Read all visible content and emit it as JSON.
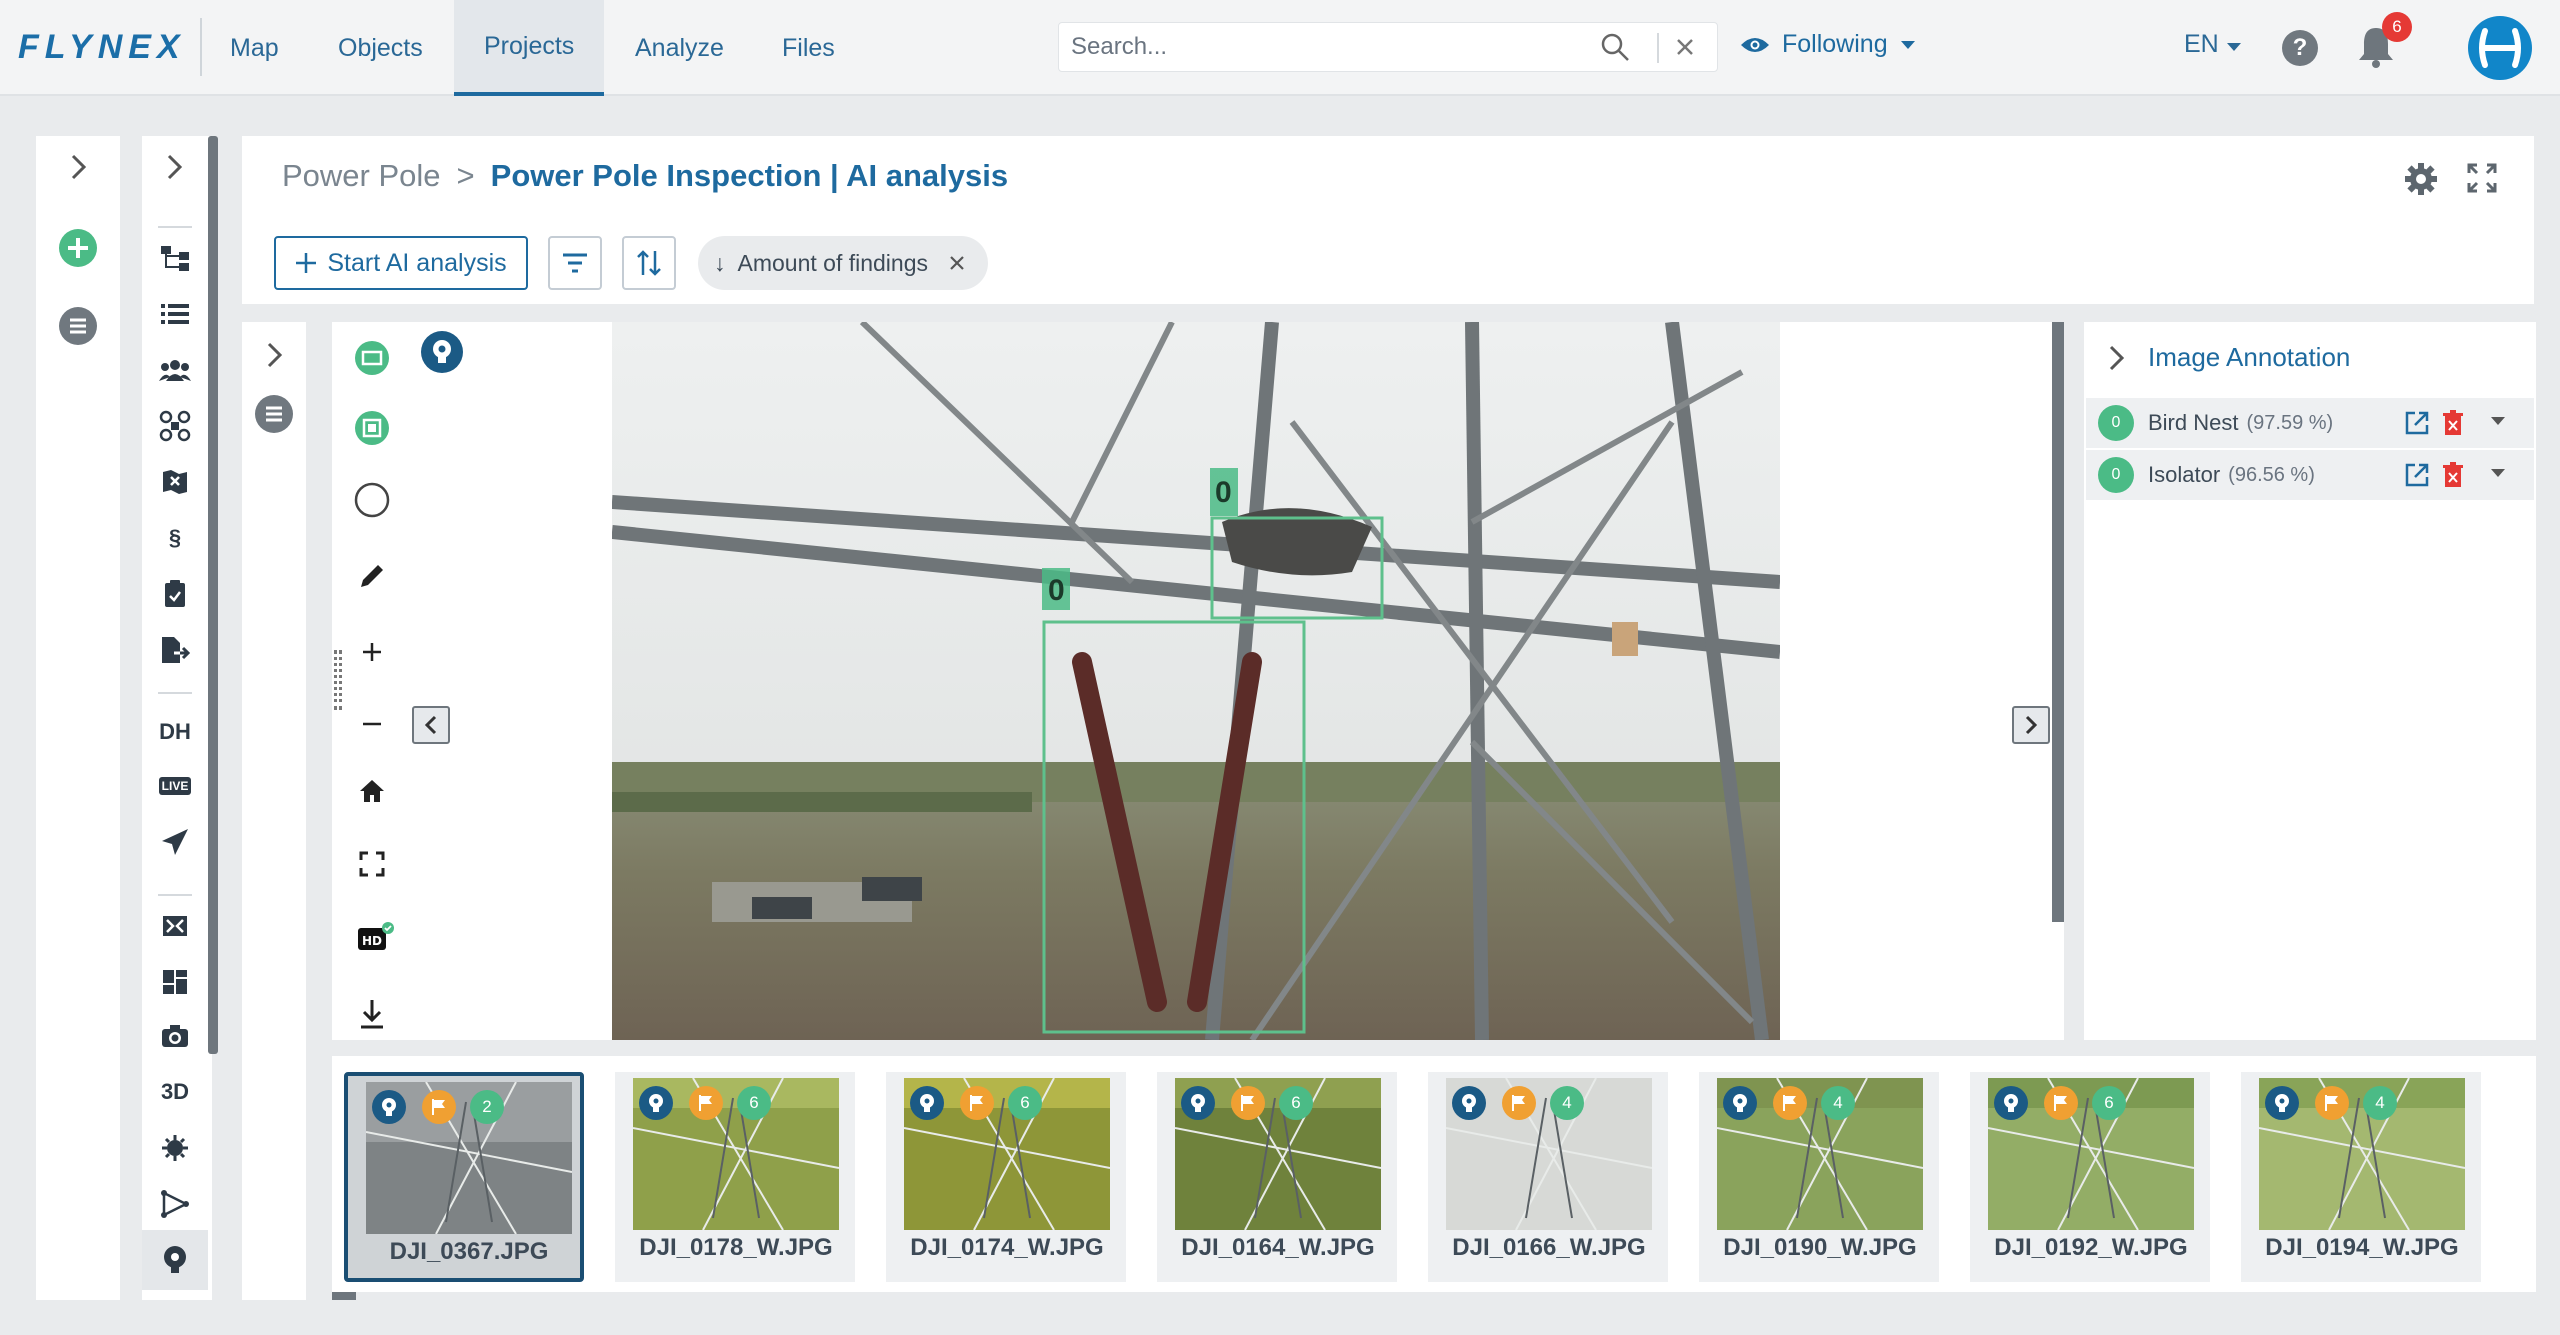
{
  "nav": {
    "logo": "FLYNEX",
    "items": [
      "Map",
      "Objects",
      "Projects",
      "Analyze",
      "Files"
    ],
    "active": "Projects",
    "search_placeholder": "Search...",
    "following": "Following",
    "language": "EN",
    "help": "?",
    "notifications": "6"
  },
  "rail_labels": {
    "dh": "DH",
    "live": "LIVE",
    "legal": "§",
    "threed": "3D"
  },
  "header": {
    "crumb_parent": "Power Pole",
    "crumb_sep": ">",
    "title": "Power Pole Inspection | AI analysis",
    "start_ai": "Start AI analysis",
    "sort_chip": "Amount of findings",
    "sort_dir": "↓"
  },
  "viewer": {
    "box_labels": [
      "0",
      "0"
    ]
  },
  "annotation": {
    "title": "Image Annotation",
    "rows": [
      {
        "count": "0",
        "label": "Bird Nest",
        "confidence": "(97.59 %)"
      },
      {
        "count": "0",
        "label": "Isolator",
        "confidence": "(96.56 %)"
      }
    ]
  },
  "thumbnails": [
    {
      "name": "DJI_0367.JPG",
      "count": "2",
      "selected": true
    },
    {
      "name": "DJI_0178_W.JPG",
      "count": "6"
    },
    {
      "name": "DJI_0174_W.JPG",
      "count": "6"
    },
    {
      "name": "DJI_0164_W.JPG",
      "count": "6"
    },
    {
      "name": "DJI_0166_W.JPG",
      "count": "4"
    },
    {
      "name": "DJI_0190_W.JPG",
      "count": "4"
    },
    {
      "name": "DJI_0192_W.JPG",
      "count": "6"
    },
    {
      "name": "DJI_0194_W.JPG",
      "count": "4"
    }
  ],
  "colors": {
    "accent": "#1e6a9f",
    "success": "#4bbb86",
    "flag": "#f0a032",
    "danger": "#e53935"
  }
}
